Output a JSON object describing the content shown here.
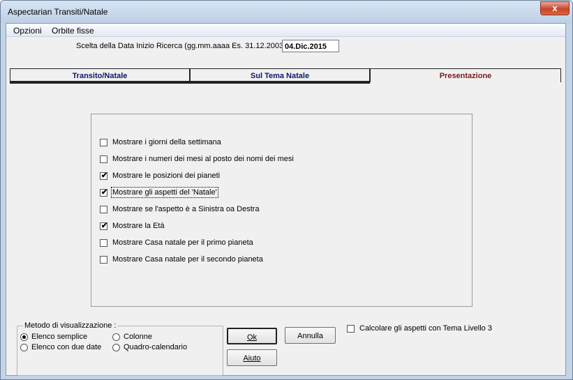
{
  "window": {
    "title": "Aspectarian Transiti/Natale",
    "close_glyph": "x"
  },
  "menu": {
    "items": [
      "Opzioni",
      "Orbite fisse"
    ]
  },
  "date": {
    "label": "Scelta della Data Inizio Ricerca (gg.mm.aaaa Es. 31.12.2003):",
    "value": "04.Dic.2015"
  },
  "tabs": [
    {
      "label": "Transito/Natale",
      "active": false
    },
    {
      "label": "Sul Tema Natale",
      "active": false
    },
    {
      "label": "Presentazione",
      "active": true
    }
  ],
  "options": [
    {
      "label": "Mostrare i giorni della settimana",
      "checked": false
    },
    {
      "label": "Mostrare i numeri dei mesi al posto dei nomi dei mesi",
      "checked": false
    },
    {
      "label": "Mostrare le posizioni dei pianeti",
      "checked": true
    },
    {
      "label": "Mostrare gli aspetti del 'Natale'",
      "checked": true,
      "focused": true
    },
    {
      "label": "Mostrare se l'aspetto è a Sinistra oa Destra",
      "checked": false
    },
    {
      "label": "Mostrare la Età",
      "checked": true
    },
    {
      "label": "Mostrare Casa natale per il primo pianeta",
      "checked": false
    },
    {
      "label": "Mostrare Casa natale per il secondo pianeta",
      "checked": false
    }
  ],
  "method": {
    "legend": "Metodo di visualizzazione :",
    "options": [
      {
        "label": "Elenco semplice",
        "selected": true
      },
      {
        "label": "Colonne",
        "selected": false
      },
      {
        "label": "Elenco con due date",
        "selected": false
      },
      {
        "label": "Quadro-calendario",
        "selected": false
      }
    ]
  },
  "buttons": {
    "ok": "Ok",
    "annulla": "Annulla",
    "aiuto": "Aiuto"
  },
  "level3": {
    "label": "Calcolare gli aspetti con Tema Livello 3",
    "checked": false
  },
  "colors": {
    "active_tab_text": "#7a1a1a",
    "tab_text": "#0b1a66"
  }
}
